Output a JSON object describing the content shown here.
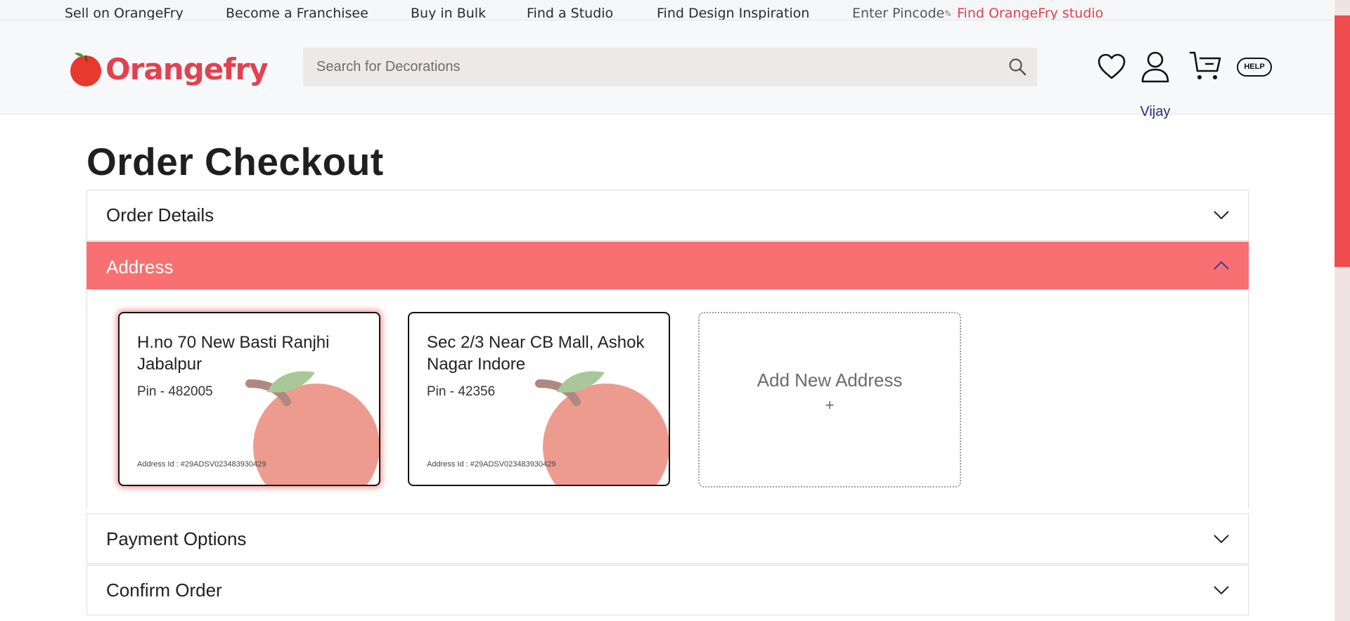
{
  "topbar": {
    "links": [
      "Sell on OrangeFry",
      "Become a Franchisee",
      "Buy in Bulk",
      "Find a Studio",
      "Find Design Inspiration"
    ],
    "pincode_label": "Enter Pincode",
    "studio_link": "Find OrangeFry studio"
  },
  "header": {
    "logo_text": "Orangefry",
    "search_placeholder": "Search for Decorations",
    "user_name": "Vijay",
    "help_label": "HELP",
    "icons": [
      "heart-icon",
      "user-icon",
      "cart-icon",
      "search-icon"
    ]
  },
  "page": {
    "title": "Order Checkout"
  },
  "accordion": {
    "sections": [
      {
        "label": "Order Details",
        "expanded": false
      },
      {
        "label": "Address",
        "expanded": true
      },
      {
        "label": "Payment Options",
        "expanded": false
      },
      {
        "label": "Confirm Order",
        "expanded": false
      }
    ]
  },
  "addresses": [
    {
      "line": "H.no 70 New Basti Ranjhi Jabalpur",
      "pin": "Pin - 482005",
      "address_id": "Address Id : #29ADSV023483930429",
      "selected": true
    },
    {
      "line": "Sec 2/3 Near CB Mall, Ashok Nagar Indore",
      "pin": "Pin - 42356",
      "address_id": "Address Id : #29ADSV023483930429",
      "selected": false
    }
  ],
  "add_address": {
    "label": "Add New Address",
    "plus": "+"
  },
  "colors": {
    "brand": "#e2414f",
    "active_section": "#f87071",
    "scroll_thumb": "#f04b4f",
    "fruit": "#ee9b8f",
    "leaf": "#a8c89a",
    "stem": "#b08880"
  }
}
